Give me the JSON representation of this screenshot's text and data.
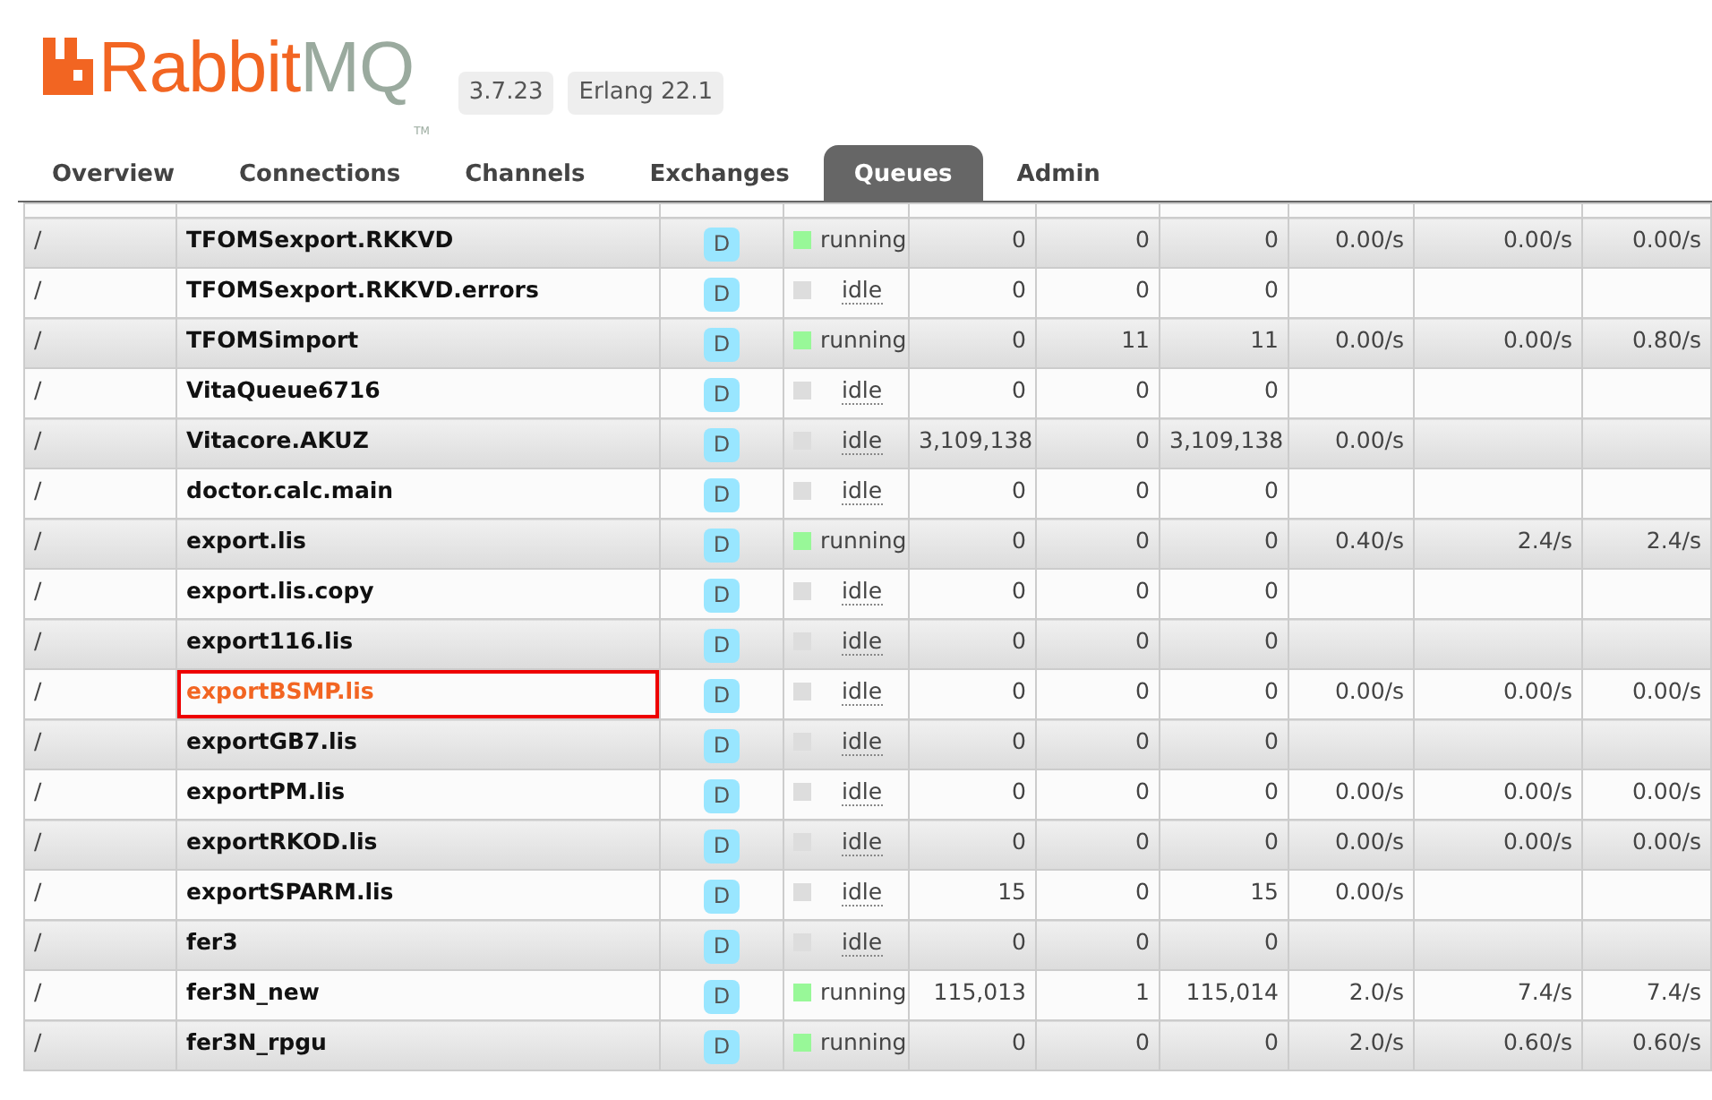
{
  "logo": {
    "part1": "Rabbit",
    "part2": "MQ",
    "tm": "TM"
  },
  "versions": [
    "3.7.23",
    "Erlang 22.1"
  ],
  "tabs": [
    {
      "label": "Overview",
      "selected": false
    },
    {
      "label": "Connections",
      "selected": false
    },
    {
      "label": "Channels",
      "selected": false
    },
    {
      "label": "Exchanges",
      "selected": false
    },
    {
      "label": "Queues",
      "selected": true
    },
    {
      "label": "Admin",
      "selected": false
    }
  ],
  "queues": [
    {
      "vhost": "/",
      "name": "TFOMSexport.RKKVD",
      "features": "D",
      "state": "running",
      "ready": "0",
      "unacked": "0",
      "total": "0",
      "incoming": "0.00/s",
      "deliver": "0.00/s",
      "ack": "0.00/s",
      "highlighted": false
    },
    {
      "vhost": "/",
      "name": "TFOMSexport.RKKVD.errors",
      "features": "D",
      "state": "idle",
      "ready": "0",
      "unacked": "0",
      "total": "0",
      "highlighted": false
    },
    {
      "vhost": "/",
      "name": "TFOMSimport",
      "features": "D",
      "state": "running",
      "ready": "0",
      "unacked": "11",
      "total": "11",
      "incoming": "0.00/s",
      "deliver": "0.00/s",
      "ack": "0.80/s",
      "highlighted": false
    },
    {
      "vhost": "/",
      "name": "VitaQueue6716",
      "features": "D",
      "state": "idle",
      "ready": "0",
      "unacked": "0",
      "total": "0",
      "highlighted": false
    },
    {
      "vhost": "/",
      "name": "Vitacore.AKUZ",
      "features": "D",
      "state": "idle",
      "ready": "3,109,138",
      "unacked": "0",
      "total": "3,109,138",
      "incoming": "0.00/s",
      "highlighted": false
    },
    {
      "vhost": "/",
      "name": "doctor.calc.main",
      "features": "D",
      "state": "idle",
      "ready": "0",
      "unacked": "0",
      "total": "0",
      "highlighted": false
    },
    {
      "vhost": "/",
      "name": "export.lis",
      "features": "D",
      "state": "running",
      "ready": "0",
      "unacked": "0",
      "total": "0",
      "incoming": "0.40/s",
      "deliver": "2.4/s",
      "ack": "2.4/s",
      "highlighted": false
    },
    {
      "vhost": "/",
      "name": "export.lis.copy",
      "features": "D",
      "state": "idle",
      "ready": "0",
      "unacked": "0",
      "total": "0",
      "highlighted": false
    },
    {
      "vhost": "/",
      "name": "export116.lis",
      "features": "D",
      "state": "idle",
      "ready": "0",
      "unacked": "0",
      "total": "0",
      "highlighted": false
    },
    {
      "vhost": "/",
      "name": "exportBSMP.lis",
      "features": "D",
      "state": "idle",
      "ready": "0",
      "unacked": "0",
      "total": "0",
      "incoming": "0.00/s",
      "deliver": "0.00/s",
      "ack": "0.00/s",
      "highlighted": true
    },
    {
      "vhost": "/",
      "name": "exportGB7.lis",
      "features": "D",
      "state": "idle",
      "ready": "0",
      "unacked": "0",
      "total": "0",
      "highlighted": false
    },
    {
      "vhost": "/",
      "name": "exportPM.lis",
      "features": "D",
      "state": "idle",
      "ready": "0",
      "unacked": "0",
      "total": "0",
      "incoming": "0.00/s",
      "deliver": "0.00/s",
      "ack": "0.00/s",
      "highlighted": false
    },
    {
      "vhost": "/",
      "name": "exportRKOD.lis",
      "features": "D",
      "state": "idle",
      "ready": "0",
      "unacked": "0",
      "total": "0",
      "incoming": "0.00/s",
      "deliver": "0.00/s",
      "ack": "0.00/s",
      "highlighted": false
    },
    {
      "vhost": "/",
      "name": "exportSPARM.lis",
      "features": "D",
      "state": "idle",
      "ready": "15",
      "unacked": "0",
      "total": "15",
      "incoming": "0.00/s",
      "highlighted": false
    },
    {
      "vhost": "/",
      "name": "fer3",
      "features": "D",
      "state": "idle",
      "ready": "0",
      "unacked": "0",
      "total": "0",
      "highlighted": false
    },
    {
      "vhost": "/",
      "name": "fer3N_new",
      "features": "D",
      "state": "running",
      "ready": "115,013",
      "unacked": "1",
      "total": "115,014",
      "incoming": "2.0/s",
      "deliver": "7.4/s",
      "ack": "7.4/s",
      "highlighted": false
    },
    {
      "vhost": "/",
      "name": "fer3N_rpgu",
      "features": "D",
      "state": "running",
      "ready": "0",
      "unacked": "0",
      "total": "0",
      "incoming": "2.0/s",
      "deliver": "0.60/s",
      "ack": "0.60/s",
      "highlighted": false
    }
  ]
}
